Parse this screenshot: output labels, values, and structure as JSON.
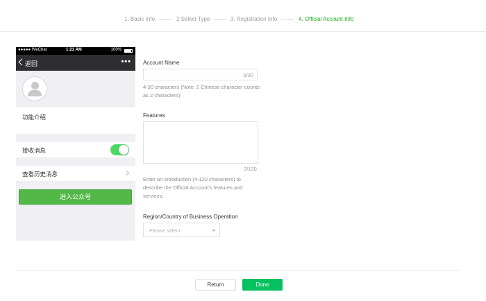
{
  "steps": [
    {
      "label": "1. Basic Info",
      "active": false
    },
    {
      "label": "2 Select Type",
      "active": false
    },
    {
      "label": "3. Registration Info",
      "active": false
    },
    {
      "label": "4. Official Account Info",
      "active": true
    }
  ],
  "colors": {
    "accent": "#1aad19",
    "done_button": "#07c160",
    "toggle_on": "#4cd964",
    "enter_button": "#53b848"
  },
  "preview": {
    "status_carrier": "●●●●● WeChat",
    "status_time": "1:21 AM",
    "status_battery": "100%",
    "back_label": "返回",
    "more_icon": "more-dots-icon",
    "intro_label": "功能介绍",
    "receive_label": "接收消息",
    "receive_enabled": true,
    "history_label": "查看历史消息",
    "enter_button": "进入公众号"
  },
  "form": {
    "account_name_label": "Account Name",
    "account_name_value": "",
    "account_name_count": "0/30",
    "account_name_hint": "4-30 characters (Note: 1 Chinese character counts as 2 characters)",
    "features_label": "Features",
    "features_value": "",
    "features_count": "0/120",
    "features_hint": "Enter an introduction (4-120 characters) to describe the Official Account's features and services.",
    "region_label": "Region/Country of Business Operation",
    "region_placeholder": "Please select"
  },
  "footer": {
    "return_label": "Return",
    "done_label": "Done"
  }
}
